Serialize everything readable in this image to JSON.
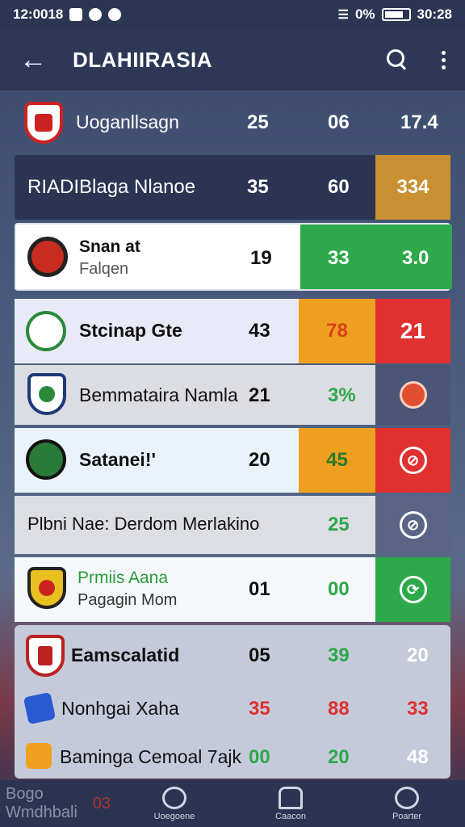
{
  "status_bar": {
    "time_left": "12:0018",
    "battery_pct": "0%",
    "time_right": "30:28"
  },
  "app_bar": {
    "title": "DLAHIIRASIA"
  },
  "rows": [
    {
      "name": "Uoganllsagn",
      "c1": "25",
      "c2": "06",
      "c3": "17.4"
    },
    {
      "name": "RIADIBlaga Nlanoe",
      "c1": "35",
      "c2": "60",
      "c3": "334"
    },
    {
      "name": "Snan at",
      "sub": "Falqen",
      "c1": "19",
      "c2": "33",
      "c3": "3.0"
    },
    {
      "name": "Stcinap Gte",
      "c1": "43",
      "c2": "78",
      "c3": "21"
    },
    {
      "name": "Bemmataira Namla",
      "c1": "21",
      "c2": "3%"
    },
    {
      "name": "Satanei!'",
      "c1": "20",
      "c2": "45"
    },
    {
      "name": "Plbni Nae: Derdom Merlakino",
      "c2": "25"
    },
    {
      "name": "Prmiis Aana",
      "sub": "Pagagin Mom",
      "c1": "01",
      "c2": "00"
    },
    {
      "name": "Eamscalatid",
      "c1": "05",
      "c2": "39",
      "c3": "20"
    },
    {
      "name": "Nonhgai Xaha",
      "c1": "35",
      "c2": "88",
      "c3": "33"
    },
    {
      "name": "Baminga Cemoal 7ajk",
      "c1": "00",
      "c2": "20",
      "c3": "48"
    }
  ],
  "nav": {
    "ghost": "Bogo Wmdhbali",
    "ghost_num": "03",
    "tab1": "Uoegoene",
    "tab2": "Caacon",
    "tab3": "Poarter"
  },
  "colors": {
    "green": "#2da84a",
    "orange": "#f0a020",
    "red": "#e03030",
    "gold": "#c89030"
  }
}
